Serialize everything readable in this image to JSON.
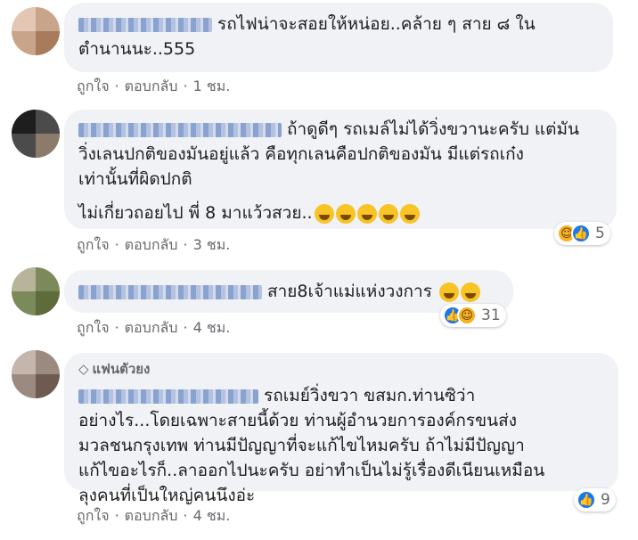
{
  "comments": [
    {
      "lines": [
        "รถไฟน่าจะสอยให้หน่อย..คล้าย ๆ สาย ๘ ใน",
        "ตำนานนะ..555"
      ],
      "actions": {
        "like": "ถูกใจ",
        "reply": "ตอบกลับ",
        "time": "1 ชม."
      }
    },
    {
      "lines": [
        "ถ้าดูดีๆ รถเมล์ไม่ได้วิ่งขวานะครับ แต่มัน",
        "วิ่งเลนปกติของมันอยู่แล้ว คือทุกเลนคือปกติของมัน มีแต่รถเก๋ง",
        "เท่านั้นที่ผิดปกติ",
        "",
        "ไม่เกี่ยวถอยไป พี่ 8 มาแว้วสวย.."
      ],
      "emoji_count": 5,
      "reactions": {
        "icons": [
          "haha",
          "like"
        ],
        "count": "5"
      },
      "actions": {
        "like": "ถูกใจ",
        "reply": "ตอบกลับ",
        "time": "3 ชม."
      }
    },
    {
      "lines": [
        "สาย8เจ้าแม่แห่งวงการ"
      ],
      "emoji_count": 2,
      "reactions": {
        "icons": [
          "like",
          "haha"
        ],
        "count": "31"
      },
      "actions": {
        "like": "ถูกใจ",
        "reply": "ตอบกลับ",
        "time": "4 ชม."
      }
    },
    {
      "badge": "แฟนตัวยง",
      "badge_icon": "diamond-icon",
      "lines": [
        "รถเมย์วิ่งขวา ขสมก.ท่านซิว่า",
        "อย่างไร...โดยเฉพาะสายนี้ด้วย ท่านผู้อำนวยการองค์กรขนส่ง",
        "มวลชนกรุงเทพ ท่านมีปัญญาที่จะแก้ไขไหมครับ ถ้าไม่มีปัญญา",
        "แก้ไขอะไรก็..ลาออกไปนะครับ อย่าทำเป็นไม่รู้เรื่องดีเนียนเหมือน",
        "ลุงคนที่เป็นใหญ่คนนึงอ่ะ"
      ],
      "reactions": {
        "icons": [
          "like"
        ],
        "count": "9"
      },
      "actions": {
        "like": "ถูกใจ",
        "reply": "ตอบกลับ",
        "time": "4 ชม."
      }
    }
  ],
  "colors": {
    "bubble": "#f0f2f5",
    "meta": "#65676b",
    "like": "#1877f2",
    "haha": "#f7b125"
  }
}
